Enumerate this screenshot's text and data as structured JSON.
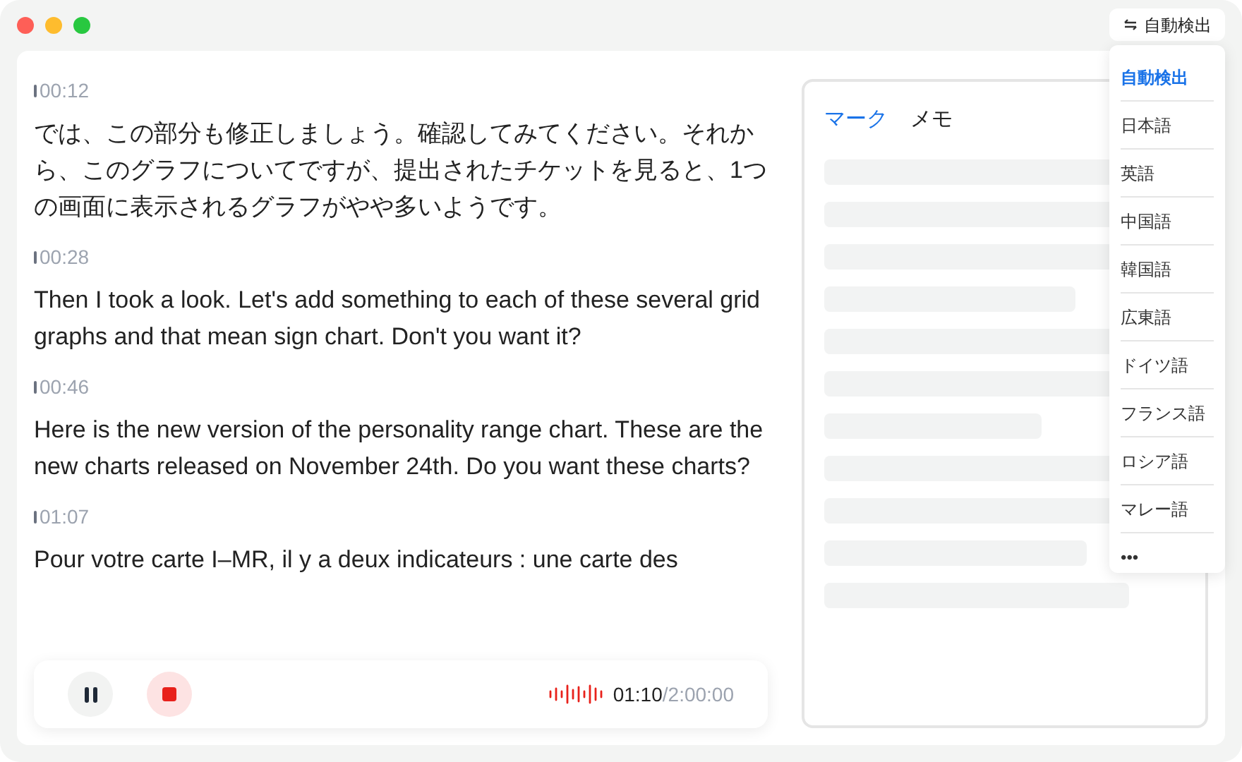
{
  "language_button": {
    "label": "自動検出"
  },
  "transcript": [
    {
      "time": "00:12",
      "text": "では、この部分も修正しましょう。確認してみてください。それから、このグラフについてですが、提出されたチケットを見ると、1つの画面に表示されるグラフがやや多いようです。"
    },
    {
      "time": "00:28",
      "text": "Then I took a look. Let's add something to each of these several grid graphs and that mean sign chart. Don't you want it?"
    },
    {
      "time": "00:46",
      "text": "Here is the new version of the personality range chart. These are the new charts released on November 24th. Do you want these charts?"
    },
    {
      "time": "01:07",
      "text": "Pour votre carte I–MR, il y a deux indicateurs : une carte des"
    }
  ],
  "player": {
    "elapsed": "01:10",
    "total": "/2:00:00"
  },
  "side_tabs": [
    {
      "label": "マーク",
      "selected": true
    },
    {
      "label": "メモ",
      "selected": false
    }
  ],
  "language_menu": [
    {
      "label": "自動検出",
      "selected": true
    },
    {
      "label": "日本語",
      "selected": false
    },
    {
      "label": "英語",
      "selected": false
    },
    {
      "label": "中国語",
      "selected": false
    },
    {
      "label": "韓国語",
      "selected": false
    },
    {
      "label": "広東語",
      "selected": false
    },
    {
      "label": "ドイツ語",
      "selected": false
    },
    {
      "label": "フランス語",
      "selected": false
    },
    {
      "label": "ロシア語",
      "selected": false
    },
    {
      "label": "マレー語",
      "selected": false
    },
    {
      "label": "•••",
      "selected": false
    }
  ]
}
